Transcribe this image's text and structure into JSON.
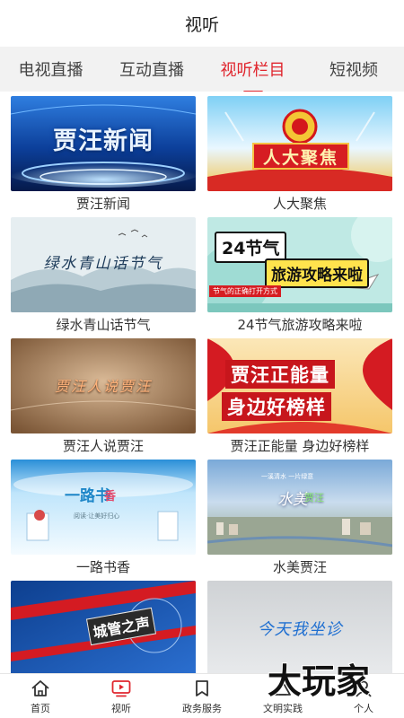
{
  "header": {
    "title": "视听"
  },
  "tabs": [
    {
      "label": "电视直播",
      "active": false
    },
    {
      "label": "互动直播",
      "active": false
    },
    {
      "label": "视听栏目",
      "active": true
    },
    {
      "label": "短视频",
      "active": false
    }
  ],
  "colors": {
    "accent": "#e0262e",
    "tab_bar_bg": "#f2f2f2",
    "text": "#333333"
  },
  "programs": [
    {
      "label": "贾汪新闻",
      "thumb_text": [
        "贾汪新闻"
      ]
    },
    {
      "label": "人大聚焦",
      "thumb_text": [
        "人大聚焦"
      ]
    },
    {
      "label": "绿水青山话节气",
      "thumb_text": [
        "绿水青山话节气"
      ]
    },
    {
      "label": "24节气旅游攻略来啦",
      "thumb_text": [
        "24节气",
        "旅游攻略来啦",
        "节气的正确打开方式"
      ]
    },
    {
      "label": "贾汪人说贾汪",
      "thumb_text": [
        "贾汪人说贾汪"
      ]
    },
    {
      "label": "贾汪正能量 身边好榜样",
      "thumb_text": [
        "贾汪正能量",
        "身边好榜样"
      ]
    },
    {
      "label": "一路书香",
      "thumb_text": [
        "一路书",
        "香",
        "阅读·让美好归心"
      ]
    },
    {
      "label": "水美贾汪",
      "thumb_text": [
        "水美",
        "贾汪",
        "一溪清水 一片绿意"
      ]
    },
    {
      "label": "",
      "thumb_text": [
        "城管之声"
      ]
    },
    {
      "label": "",
      "thumb_text": [
        "今天我坐诊"
      ]
    }
  ],
  "bottom_nav": [
    {
      "label": "首页",
      "icon": "home-icon",
      "active": false
    },
    {
      "label": "视听",
      "icon": "tv-play-icon",
      "active": true
    },
    {
      "label": "政务服务",
      "icon": "bookmark-icon",
      "active": false
    },
    {
      "label": "文明实践",
      "icon": "civilization-icon",
      "active": false
    },
    {
      "label": "个人",
      "icon": "person-icon",
      "active": false
    }
  ],
  "watermark": {
    "text": "大玩家"
  }
}
